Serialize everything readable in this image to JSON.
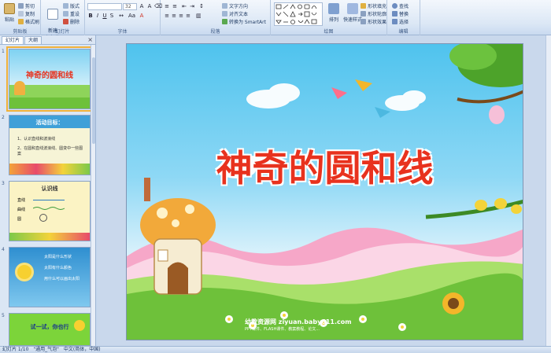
{
  "ribbon": {
    "clipboard": {
      "paste": "粘贴",
      "cut": "剪切",
      "copy": "复制",
      "format_painter": "格式刷",
      "label": "剪贴板"
    },
    "slides": {
      "new_slide": "新建\n幻灯片",
      "layout": "版式",
      "reset": "重设",
      "delete": "删除",
      "label": "幻灯片"
    },
    "font": {
      "font_size": "32",
      "label": "字体"
    },
    "paragraph": {
      "text_direction": "文字方向",
      "align_text": "对齐文本",
      "convert_smartart": "转换为 SmartArt",
      "label": "段落"
    },
    "drawing": {
      "arrange": "排列",
      "quick_styles": "快速样式",
      "shape_fill": "形状填充",
      "shape_outline": "形状轮廓",
      "shape_effects": "形状效果",
      "label": "绘图"
    },
    "editing": {
      "find": "查找",
      "replace": "替换",
      "select": "选择",
      "label": "编辑"
    }
  },
  "pane": {
    "tabs": [
      "幻灯片",
      "大纲"
    ],
    "close": "×",
    "slides": [
      {
        "num": "1",
        "title": "神奇的圆和线"
      },
      {
        "num": "2",
        "title": "活动目标：",
        "items": [
          "1、认识直线和波浪线",
          "2、在圆和直线波浪线、圆变中一些图案"
        ]
      },
      {
        "num": "3",
        "title": "认识线",
        "items": [
          "直线",
          "曲线",
          "圆"
        ]
      },
      {
        "num": "4",
        "items": [
          "太阳是什么形状",
          "太阳有什么颜色",
          "用什么可以画出太阳"
        ]
      },
      {
        "num": "5",
        "title": "试一试，你也行"
      }
    ]
  },
  "slide": {
    "title": "神奇的圆和线",
    "footer": "幼教资源网 ziyuan.baby611.com",
    "footer_sub": "PPT课件、FLASH课件、教案教程、论文..."
  },
  "status": {
    "slide_info": "幻灯片 1/10",
    "theme": "\"通用_气泡\"",
    "language": "中文(简体，中国)"
  },
  "colors": {
    "title_red": "#e8321e",
    "sky": "#4fc3ee",
    "grass": "#6ec13a",
    "selected_outline": "#f0b13a"
  }
}
